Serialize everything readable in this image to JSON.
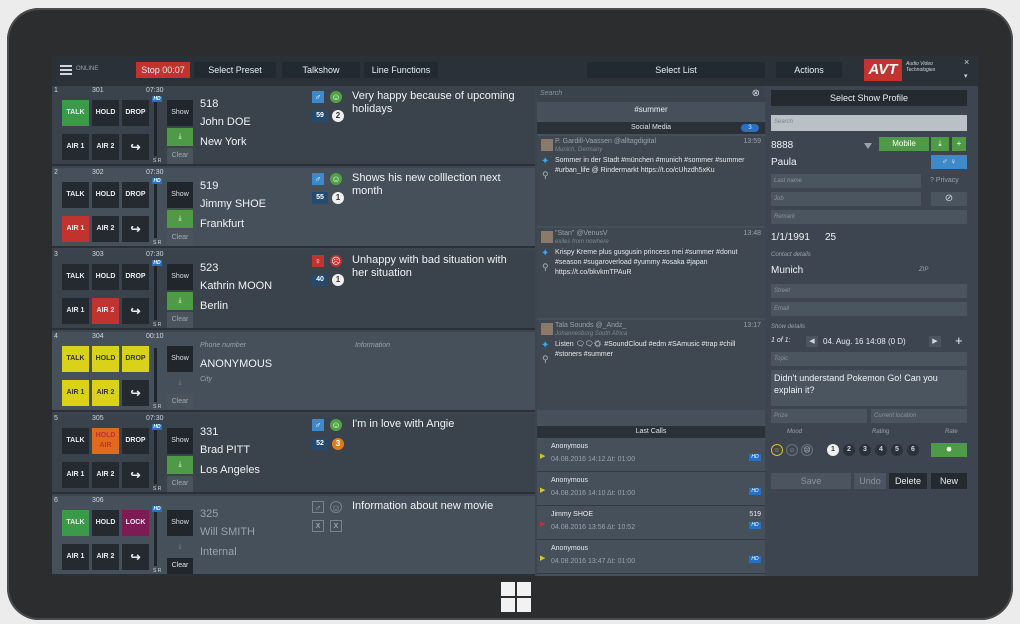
{
  "topbar": {
    "online": "ONLINE",
    "stop": "Stop 00:07",
    "select_preset": "Select Preset",
    "talkshow": "Talkshow",
    "line_functions": "Line Functions",
    "select_list": "Select List",
    "actions": "Actions",
    "logo": "AVT",
    "logo_sub": "Audio Video Technologies",
    "close": "×",
    "chevron": "▾"
  },
  "lines": [
    {
      "num": "1",
      "ext": "301",
      "time": "07:30",
      "number": "518",
      "name": "John DOE",
      "city": "New York",
      "age": "59",
      "rank": "2",
      "note": "Very happy because of upcoming holidays",
      "gender": "♂",
      "mood": "☺"
    },
    {
      "num": "2",
      "ext": "302",
      "time": "07:30",
      "number": "519",
      "name": "Jimmy SHOE",
      "city": "Frankfurt",
      "age": "55",
      "rank": "1",
      "note": "Shows his new colllection next month",
      "gender": "♂",
      "mood": "☺"
    },
    {
      "num": "3",
      "ext": "303",
      "time": "07:30",
      "number": "523",
      "name": "Kathrin MOON",
      "city": "Berlin",
      "age": "40",
      "rank": "1",
      "note": "Unhappy with bad situation with her situation",
      "gender": "♀",
      "mood": "☹"
    },
    {
      "num": "4",
      "ext": "304",
      "time": "00:10",
      "phone_label": "Phone number",
      "info_label": "Information",
      "name": "ANONYMOUS",
      "city_label": "City"
    },
    {
      "num": "5",
      "ext": "305",
      "time": "07:30",
      "number": "331",
      "name": "Brad PITT",
      "city": "Los Angeles",
      "age": "52",
      "rank": "3",
      "note": "I'm in love with Angie",
      "gender": "♂",
      "mood": "☺"
    },
    {
      "num": "6",
      "ext": "306",
      "time": "",
      "number": "325",
      "name": "Will SMITH",
      "city": "Internal",
      "note": "Information about new movie",
      "gender": "♂",
      "mood": "☺",
      "x": "X"
    }
  ],
  "buttons": {
    "talk": "TALK",
    "hold": "HOLD",
    "drop": "DROP",
    "lock": "LOCK",
    "air1": "AIR 1",
    "air2": "AIR 2",
    "fwd": "↪",
    "show": "Show",
    "clear": "Clear",
    "hold_air": "HOLD AIR",
    "sr": "S R",
    "hd": "HD",
    "dl": "⤓"
  },
  "social": {
    "search": "Search",
    "search_x": "⊗",
    "tag": "#summer",
    "head": "Social Media",
    "count": "3",
    "tweets": [
      {
        "user": "P. Gardill-Vaassen  @alltagdigital",
        "loc": "Munich, Germany",
        "time": "13:59",
        "text": "Sommer in der Stadt #münchen #munich #sommer #summer #urban_life @ Rindermarkt https://t.co/cUhzdh5xKu"
      },
      {
        "user": "\"Stan\"  @VenusV",
        "loc": "exiles from nowhere",
        "time": "13:48",
        "text": "Krispy Kreme plus gusgusin princess mei #summer #donut #season #sugaroverload #yummy #osaka #japan https://t.co/bkvkmTPAuR"
      },
      {
        "user": "Tala Sounds  @_Andz_",
        "loc": "Johannesburg South Africa",
        "time": "13:17",
        "text": "Listen 🗨🗨☀ #SoundCloud #edm #SAmusic #trap #chill #stoners #summer"
      }
    ],
    "last_calls": "Last Calls",
    "calls": [
      {
        "name": "Anonymous",
        "date": "04.08.2016  14:12   Δt: 01:00",
        "hd": "HD",
        "ext": ""
      },
      {
        "name": "Anonymous",
        "date": "04.08.2016  14:10   Δt: 01:00",
        "hd": "HD",
        "ext": ""
      },
      {
        "name": "Jimmy SHOE",
        "date": "04.08.2016  13:56   Δt: 10:52",
        "hd": "HD",
        "ext": "519"
      },
      {
        "name": "Anonymous",
        "date": "04.08.2016  13:47   Δt: 01:00",
        "hd": "HD",
        "ext": ""
      }
    ]
  },
  "profile": {
    "title": "Select Show Profile",
    "search": "Search",
    "phone": "8888",
    "mobile": "Mobile",
    "first": "Paula",
    "gender_btn": "♂ ♀",
    "lastname": "Last name",
    "privacy": "? Privacy",
    "job": "Job",
    "remark": "Remark",
    "dob": "1/1/1991",
    "age": "25",
    "contact_details": "Contact details",
    "city": "Munich",
    "zip": "ZIP",
    "street": "Street",
    "email": "Email",
    "show_details": "Show details",
    "of": "1 of 1:",
    "date": "04. Aug. 16  14:08  (0 D)",
    "topic": "Topic",
    "question": "Didn't understand Pokemon Go! Can you explain it?",
    "prize": "Prize",
    "location": "Current location",
    "mood": "Mood",
    "rating": "Rating",
    "rate": "Rate",
    "save": "Save",
    "undo": "Undo",
    "delete": "Delete",
    "new": "New",
    "plus": "+",
    "ratings": [
      "1",
      "2",
      "3",
      "4",
      "5",
      "6"
    ]
  }
}
